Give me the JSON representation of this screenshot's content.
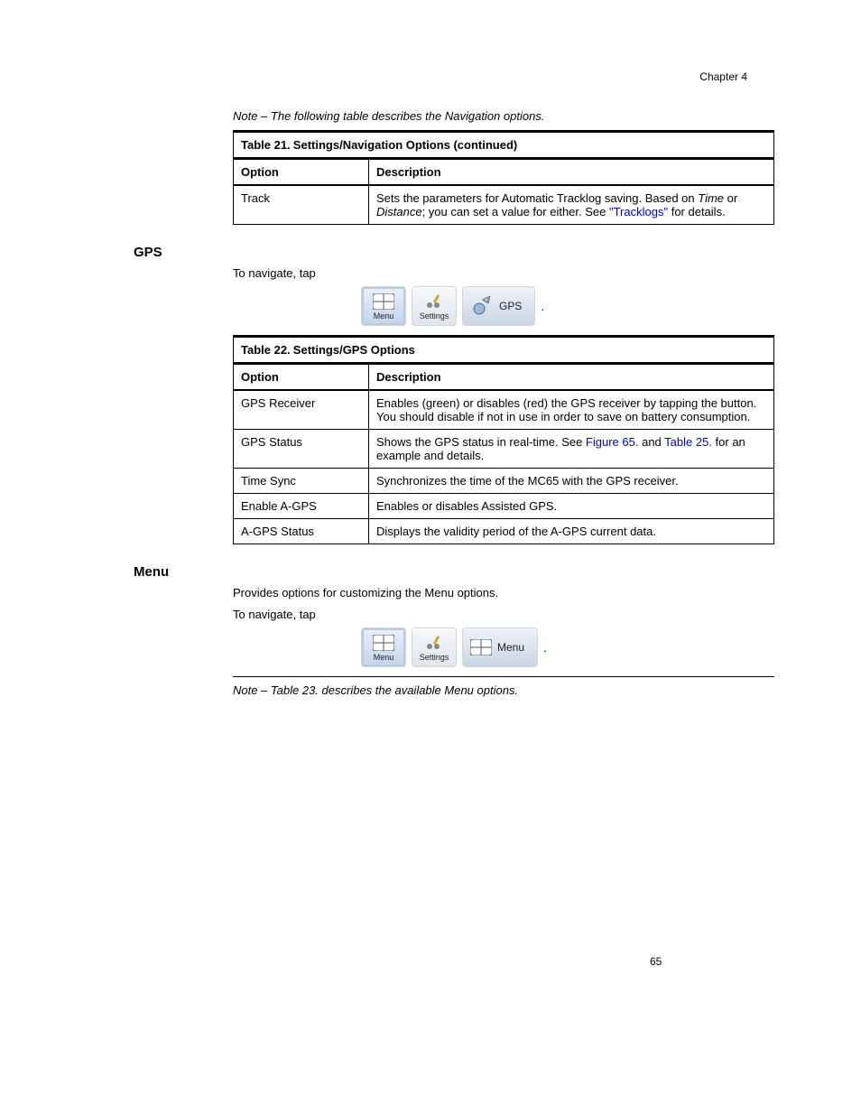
{
  "header_right": "Chapter 4",
  "intro_note": "Note – The following table describes the Navigation options.",
  "table1": {
    "caption": "Table 21.\tSettings/Navigation Options (continued)",
    "headers": [
      "Option",
      "Description"
    ],
    "rows": [
      {
        "option": "Track",
        "desc_lead": "Sets the parameters for Automatic Tracklog saving. Based on ",
        "desc_ital": "Time",
        "desc_mid": " or ",
        "desc_ital2": "Distance",
        "desc_tail": "; you can set a value for either. See ",
        "desc_link": "\"Tracklogs\"",
        "desc_after": " for details."
      }
    ]
  },
  "gps_heading": "GPS",
  "gps_nav_prefix": "To navigate, tap ",
  "gps_nav_suffix": ".",
  "table2": {
    "caption": "Table 22.\tSettings/GPS Options",
    "headers": [
      "Option",
      "Description"
    ],
    "rows": [
      {
        "option": "GPS Receiver",
        "desc_lines": [
          "Enables (green) or disables (red) the GPS receiver by tapping the button.",
          "You should disable if not in use in order to save on battery consumption."
        ]
      },
      {
        "option": "GPS Status",
        "desc_before": "Shows the GPS status in real-time. See ",
        "desc_link": "Figure 65.",
        "desc_mid": " and ",
        "desc_link2": "Table 25.",
        "desc_after": " for an example and details."
      },
      {
        "option": "Time Sync",
        "desc": "Synchronizes the time of the MC65 with the GPS receiver."
      },
      {
        "option": "Enable A-GPS",
        "desc": "Enables or disables Assisted GPS."
      },
      {
        "option": "A-GPS Status",
        "desc": "Displays the validity period of the A-GPS current data."
      }
    ]
  },
  "menu_heading": "Menu",
  "menu_para1": "Provides options for customizing the Menu options.",
  "menu_nav_prefix": "To navigate, tap ",
  "menu_nav_suffix": ".",
  "menu_note": "Note – Table 23. describes the available Menu options.",
  "toolbar": {
    "menu": "Menu",
    "settings": "Settings",
    "gps": "GPS",
    "menu_wide": "Menu"
  },
  "page_number": "65"
}
